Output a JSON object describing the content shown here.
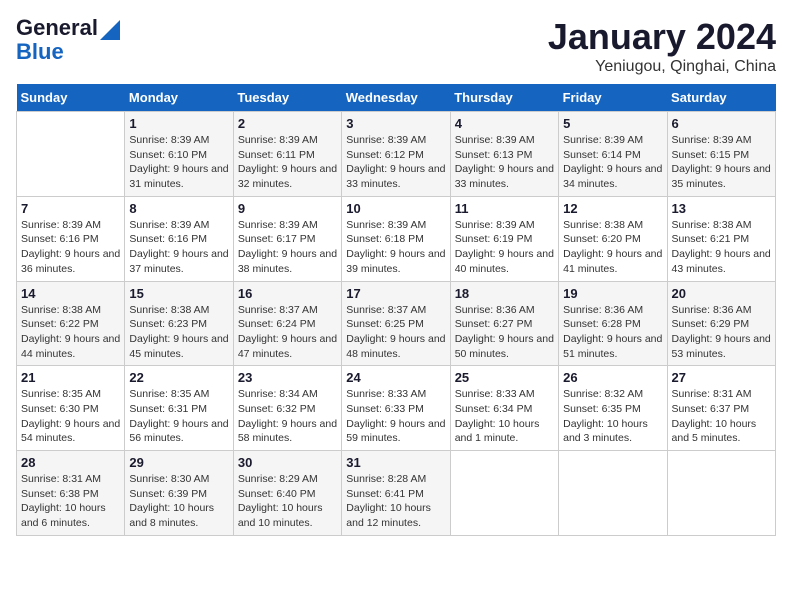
{
  "header": {
    "logo_line1": "General",
    "logo_line2": "Blue",
    "title": "January 2024",
    "subtitle": "Yeniugou, Qinghai, China"
  },
  "days_of_week": [
    "Sunday",
    "Monday",
    "Tuesday",
    "Wednesday",
    "Thursday",
    "Friday",
    "Saturday"
  ],
  "weeks": [
    [
      {
        "day": "",
        "sunrise": "",
        "sunset": "",
        "daylight": ""
      },
      {
        "day": "1",
        "sunrise": "Sunrise: 8:39 AM",
        "sunset": "Sunset: 6:10 PM",
        "daylight": "Daylight: 9 hours and 31 minutes."
      },
      {
        "day": "2",
        "sunrise": "Sunrise: 8:39 AM",
        "sunset": "Sunset: 6:11 PM",
        "daylight": "Daylight: 9 hours and 32 minutes."
      },
      {
        "day": "3",
        "sunrise": "Sunrise: 8:39 AM",
        "sunset": "Sunset: 6:12 PM",
        "daylight": "Daylight: 9 hours and 33 minutes."
      },
      {
        "day": "4",
        "sunrise": "Sunrise: 8:39 AM",
        "sunset": "Sunset: 6:13 PM",
        "daylight": "Daylight: 9 hours and 33 minutes."
      },
      {
        "day": "5",
        "sunrise": "Sunrise: 8:39 AM",
        "sunset": "Sunset: 6:14 PM",
        "daylight": "Daylight: 9 hours and 34 minutes."
      },
      {
        "day": "6",
        "sunrise": "Sunrise: 8:39 AM",
        "sunset": "Sunset: 6:15 PM",
        "daylight": "Daylight: 9 hours and 35 minutes."
      }
    ],
    [
      {
        "day": "7",
        "sunrise": "Sunrise: 8:39 AM",
        "sunset": "Sunset: 6:16 PM",
        "daylight": "Daylight: 9 hours and 36 minutes."
      },
      {
        "day": "8",
        "sunrise": "Sunrise: 8:39 AM",
        "sunset": "Sunset: 6:16 PM",
        "daylight": "Daylight: 9 hours and 37 minutes."
      },
      {
        "day": "9",
        "sunrise": "Sunrise: 8:39 AM",
        "sunset": "Sunset: 6:17 PM",
        "daylight": "Daylight: 9 hours and 38 minutes."
      },
      {
        "day": "10",
        "sunrise": "Sunrise: 8:39 AM",
        "sunset": "Sunset: 6:18 PM",
        "daylight": "Daylight: 9 hours and 39 minutes."
      },
      {
        "day": "11",
        "sunrise": "Sunrise: 8:39 AM",
        "sunset": "Sunset: 6:19 PM",
        "daylight": "Daylight: 9 hours and 40 minutes."
      },
      {
        "day": "12",
        "sunrise": "Sunrise: 8:38 AM",
        "sunset": "Sunset: 6:20 PM",
        "daylight": "Daylight: 9 hours and 41 minutes."
      },
      {
        "day": "13",
        "sunrise": "Sunrise: 8:38 AM",
        "sunset": "Sunset: 6:21 PM",
        "daylight": "Daylight: 9 hours and 43 minutes."
      }
    ],
    [
      {
        "day": "14",
        "sunrise": "Sunrise: 8:38 AM",
        "sunset": "Sunset: 6:22 PM",
        "daylight": "Daylight: 9 hours and 44 minutes."
      },
      {
        "day": "15",
        "sunrise": "Sunrise: 8:38 AM",
        "sunset": "Sunset: 6:23 PM",
        "daylight": "Daylight: 9 hours and 45 minutes."
      },
      {
        "day": "16",
        "sunrise": "Sunrise: 8:37 AM",
        "sunset": "Sunset: 6:24 PM",
        "daylight": "Daylight: 9 hours and 47 minutes."
      },
      {
        "day": "17",
        "sunrise": "Sunrise: 8:37 AM",
        "sunset": "Sunset: 6:25 PM",
        "daylight": "Daylight: 9 hours and 48 minutes."
      },
      {
        "day": "18",
        "sunrise": "Sunrise: 8:36 AM",
        "sunset": "Sunset: 6:27 PM",
        "daylight": "Daylight: 9 hours and 50 minutes."
      },
      {
        "day": "19",
        "sunrise": "Sunrise: 8:36 AM",
        "sunset": "Sunset: 6:28 PM",
        "daylight": "Daylight: 9 hours and 51 minutes."
      },
      {
        "day": "20",
        "sunrise": "Sunrise: 8:36 AM",
        "sunset": "Sunset: 6:29 PM",
        "daylight": "Daylight: 9 hours and 53 minutes."
      }
    ],
    [
      {
        "day": "21",
        "sunrise": "Sunrise: 8:35 AM",
        "sunset": "Sunset: 6:30 PM",
        "daylight": "Daylight: 9 hours and 54 minutes."
      },
      {
        "day": "22",
        "sunrise": "Sunrise: 8:35 AM",
        "sunset": "Sunset: 6:31 PM",
        "daylight": "Daylight: 9 hours and 56 minutes."
      },
      {
        "day": "23",
        "sunrise": "Sunrise: 8:34 AM",
        "sunset": "Sunset: 6:32 PM",
        "daylight": "Daylight: 9 hours and 58 minutes."
      },
      {
        "day": "24",
        "sunrise": "Sunrise: 8:33 AM",
        "sunset": "Sunset: 6:33 PM",
        "daylight": "Daylight: 9 hours and 59 minutes."
      },
      {
        "day": "25",
        "sunrise": "Sunrise: 8:33 AM",
        "sunset": "Sunset: 6:34 PM",
        "daylight": "Daylight: 10 hours and 1 minute."
      },
      {
        "day": "26",
        "sunrise": "Sunrise: 8:32 AM",
        "sunset": "Sunset: 6:35 PM",
        "daylight": "Daylight: 10 hours and 3 minutes."
      },
      {
        "day": "27",
        "sunrise": "Sunrise: 8:31 AM",
        "sunset": "Sunset: 6:37 PM",
        "daylight": "Daylight: 10 hours and 5 minutes."
      }
    ],
    [
      {
        "day": "28",
        "sunrise": "Sunrise: 8:31 AM",
        "sunset": "Sunset: 6:38 PM",
        "daylight": "Daylight: 10 hours and 6 minutes."
      },
      {
        "day": "29",
        "sunrise": "Sunrise: 8:30 AM",
        "sunset": "Sunset: 6:39 PM",
        "daylight": "Daylight: 10 hours and 8 minutes."
      },
      {
        "day": "30",
        "sunrise": "Sunrise: 8:29 AM",
        "sunset": "Sunset: 6:40 PM",
        "daylight": "Daylight: 10 hours and 10 minutes."
      },
      {
        "day": "31",
        "sunrise": "Sunrise: 8:28 AM",
        "sunset": "Sunset: 6:41 PM",
        "daylight": "Daylight: 10 hours and 12 minutes."
      },
      {
        "day": "",
        "sunrise": "",
        "sunset": "",
        "daylight": ""
      },
      {
        "day": "",
        "sunrise": "",
        "sunset": "",
        "daylight": ""
      },
      {
        "day": "",
        "sunrise": "",
        "sunset": "",
        "daylight": ""
      }
    ]
  ]
}
